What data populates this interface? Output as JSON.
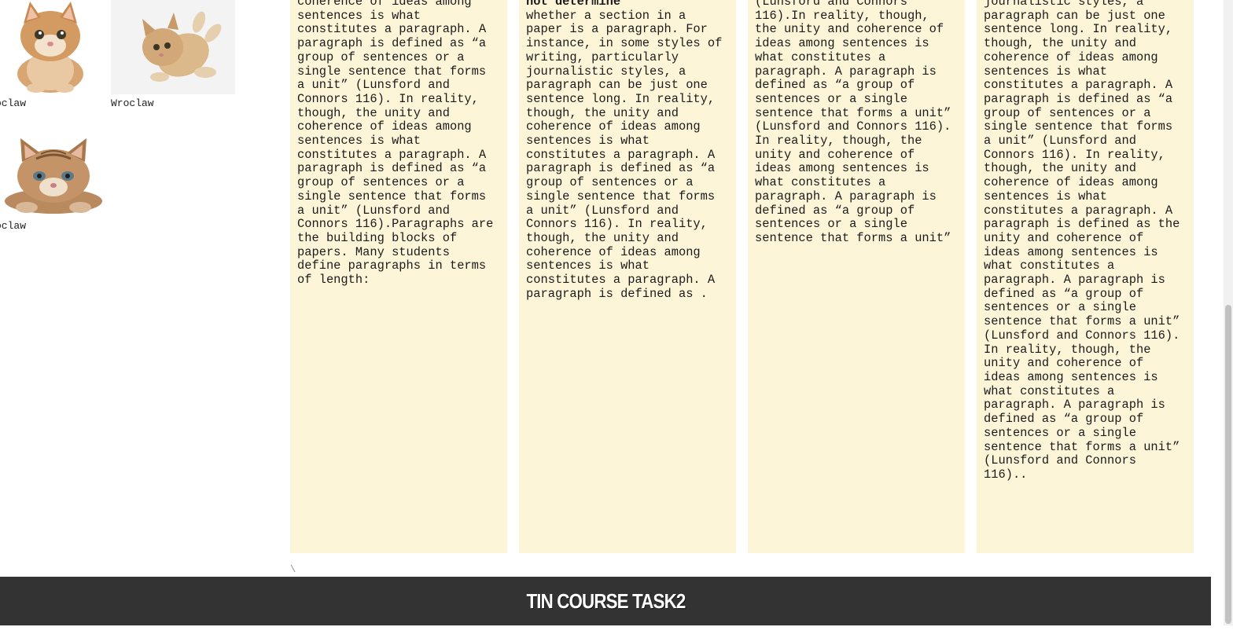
{
  "gallery": {
    "items": [
      {
        "caption": "oclaw",
        "image": "kitten-sitting-photo"
      },
      {
        "caption": "Wroclaw",
        "image": "kitten-rolling-photo"
      },
      {
        "caption": "oclaw",
        "image": "kitten-lying-photo"
      }
    ]
  },
  "columns": [
    {
      "top_fragment": "coherence of ideas among",
      "text": "sentences is what constitutes a paragraph. A paragraph is defined as “a group of sentences or a single sentence that forms a unit” (Lunsford and Connors 116). In reality, though, the unity and coherence of ideas among sentences is what constitutes a paragraph. A paragraph is defined as “a group of sentences or a single sentence that forms a unit” (Lunsford and Connors 116).Paragraphs are the building blocks of papers. Many students define paragraphs in terms of length:"
    },
    {
      "top_fragment": "not determine",
      "text": "whether a section in a paper is a paragraph. For instance, in some styles of writing, particularly journalistic styles, a paragraph can be just one sentence long. In reality, though, the unity and coherence of ideas among sentences is what constitutes a paragraph. A paragraph is defined as “a group of sentences or a single sentence that forms a unit” (Lunsford and Connors 116). In reality, though, the unity and coherence of ideas among sentences is what constitutes a paragraph. A paragraph is defined as ."
    },
    {
      "top_fragment": "(Lunsford and Connors",
      "text": "116).In reality, though, the unity and coherence of ideas among sentences is what constitutes a paragraph. A paragraph is defined as “a group of sentences or a single sentence that forms a unit” (Lunsford and Connors 116). In reality, though, the unity and coherence of ideas among sentences is what constitutes a paragraph. A paragraph is defined as “a group of sentences or a single sentence that forms a unit”"
    },
    {
      "top_fragment": "journalistic styles, a",
      "text": "paragraph can be just one sentence long. In reality, though, the unity and coherence of ideas among sentences is what constitutes a paragraph. A paragraph is defined as “a group of sentences or a single sentence that forms a unit” (Lunsford and Connors 116). In reality, though, the unity and coherence of ideas among sentences is what constitutes a paragraph. A paragraph is defined as the unity and coherence of ideas among sentences is what constitutes a paragraph. A paragraph is defined as “a group of sentences or a single sentence that forms a unit” (Lunsford and Connors 116). In reality, though, the unity and coherence of ideas among sentences is what constitutes a paragraph. A paragraph is defined as “a group of sentences or a single sentence that forms a unit” (Lunsford and Connors 116).."
    }
  ],
  "stray_mark": "\\",
  "footer": {
    "title": "TIN COURSE TASK2"
  },
  "colors": {
    "column_bg": "#fdf5d8",
    "footer_bg": "#333333",
    "footer_text": "#ffffff"
  }
}
